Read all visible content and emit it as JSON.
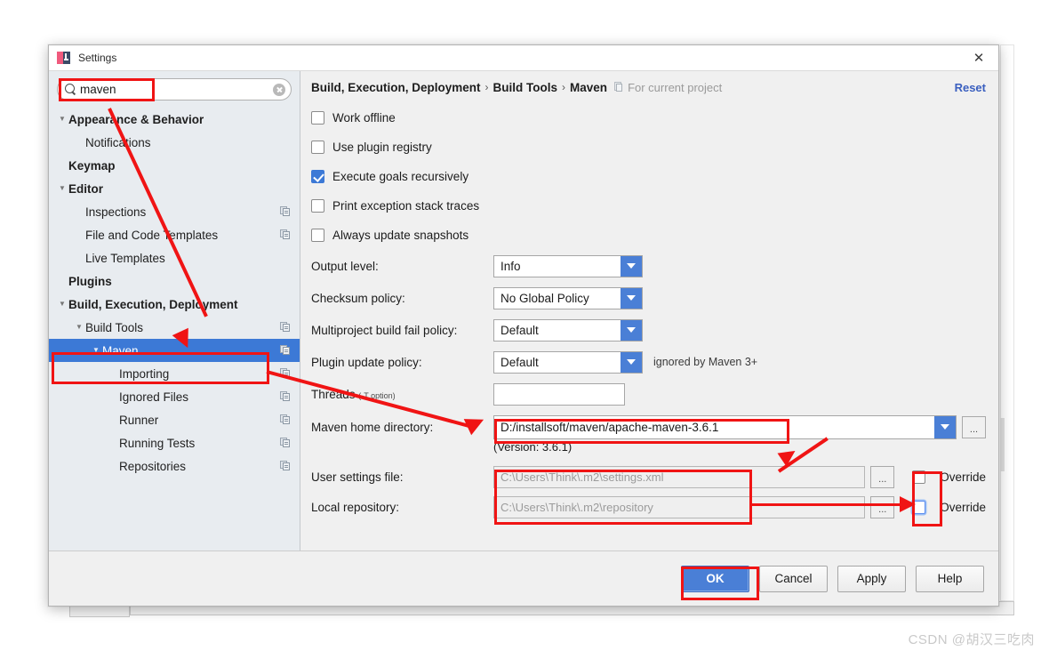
{
  "window": {
    "title": "Settings",
    "app_icon": "intellij-idea-icon",
    "close_label": "✕"
  },
  "search": {
    "value": "maven",
    "placeholder": "",
    "icon": "search-icon",
    "clear_icon": "clear-icon"
  },
  "sidebar": {
    "items": [
      {
        "label": "Appearance & Behavior",
        "indent": 0,
        "arrow": "▼",
        "bold": true,
        "copy": false,
        "selected": false
      },
      {
        "label": "Notifications",
        "indent": 1,
        "arrow": "",
        "bold": false,
        "copy": false,
        "selected": false
      },
      {
        "label": "Keymap",
        "indent": 0,
        "arrow": "",
        "bold": true,
        "copy": false,
        "selected": false
      },
      {
        "label": "Editor",
        "indent": 0,
        "arrow": "▼",
        "bold": true,
        "copy": false,
        "selected": false
      },
      {
        "label": "Inspections",
        "indent": 1,
        "arrow": "",
        "bold": false,
        "copy": true,
        "selected": false
      },
      {
        "label": "File and Code Templates",
        "indent": 1,
        "arrow": "",
        "bold": false,
        "copy": true,
        "selected": false
      },
      {
        "label": "Live Templates",
        "indent": 1,
        "arrow": "",
        "bold": false,
        "copy": false,
        "selected": false
      },
      {
        "label": "Plugins",
        "indent": 0,
        "arrow": "",
        "bold": true,
        "copy": false,
        "selected": false
      },
      {
        "label": "Build, Execution, Deployment",
        "indent": 0,
        "arrow": "▼",
        "bold": true,
        "copy": false,
        "selected": false
      },
      {
        "label": "Build Tools",
        "indent": 1,
        "arrow": "▼",
        "bold": false,
        "copy": true,
        "selected": false
      },
      {
        "label": "Maven",
        "indent": 2,
        "arrow": "▼",
        "bold": false,
        "copy": true,
        "selected": true
      },
      {
        "label": "Importing",
        "indent": 3,
        "arrow": "",
        "bold": false,
        "copy": true,
        "selected": false
      },
      {
        "label": "Ignored Files",
        "indent": 3,
        "arrow": "",
        "bold": false,
        "copy": true,
        "selected": false
      },
      {
        "label": "Runner",
        "indent": 3,
        "arrow": "",
        "bold": false,
        "copy": true,
        "selected": false
      },
      {
        "label": "Running Tests",
        "indent": 3,
        "arrow": "",
        "bold": false,
        "copy": true,
        "selected": false
      },
      {
        "label": "Repositories",
        "indent": 3,
        "arrow": "",
        "bold": false,
        "copy": true,
        "selected": false
      }
    ]
  },
  "breadcrumb": {
    "part1": "Build, Execution, Deployment",
    "sep1": "›",
    "part2": "Build Tools",
    "sep2": "›",
    "part3": "Maven",
    "scope_icon": "project-scope-icon",
    "scope_note": "For current project",
    "reset_label": "Reset"
  },
  "settings": {
    "checkboxes": [
      {
        "label": "Work offline",
        "checked": false,
        "mnemonic_index": 5
      },
      {
        "label": "Use plugin registry",
        "checked": false,
        "mnemonic_index": 11
      },
      {
        "label": "Execute goals recursively",
        "checked": true,
        "mnemonic_index": 8
      },
      {
        "label": "Print exception stack traces",
        "checked": false,
        "mnemonic_index": 6
      },
      {
        "label": "Always update snapshots",
        "checked": false,
        "mnemonic_index": 14
      }
    ],
    "combos": [
      {
        "label": "Output level:",
        "value": "Info",
        "note": ""
      },
      {
        "label": "Checksum policy:",
        "value": "No Global Policy",
        "note": ""
      },
      {
        "label": "Multiproject build fail policy:",
        "value": "Default",
        "note": ""
      },
      {
        "label": "Plugin update policy:",
        "value": "Default",
        "note": "ignored by Maven 3+"
      }
    ],
    "threads": {
      "label": "Threads",
      "label_suffix": "(-T option)",
      "value": ""
    },
    "maven_home": {
      "label": "Maven home directory:",
      "value": "D:/installsoft/maven/apache-maven-3.6.1",
      "browse_label": "...",
      "version_note": "(Version: 3.6.1)"
    },
    "user_settings": {
      "label": "User settings file:",
      "value": "C:\\Users\\Think\\.m2\\settings.xml",
      "browse_label": "...",
      "override_label": "Override",
      "override_checked": false
    },
    "local_repository": {
      "label": "Local repository:",
      "value": "C:\\Users\\Think\\.m2\\repository",
      "browse_label": "...",
      "override_label": "Override",
      "override_checked": false
    }
  },
  "footer": {
    "buttons": [
      {
        "label": "OK",
        "primary": true
      },
      {
        "label": "Cancel",
        "primary": false
      },
      {
        "label": "Apply",
        "primary": false
      },
      {
        "label": "Help",
        "primary": false
      }
    ]
  },
  "watermark": {
    "text": "CSDN @胡汉三吃肉"
  },
  "annotation": {
    "color": "#f01414"
  }
}
